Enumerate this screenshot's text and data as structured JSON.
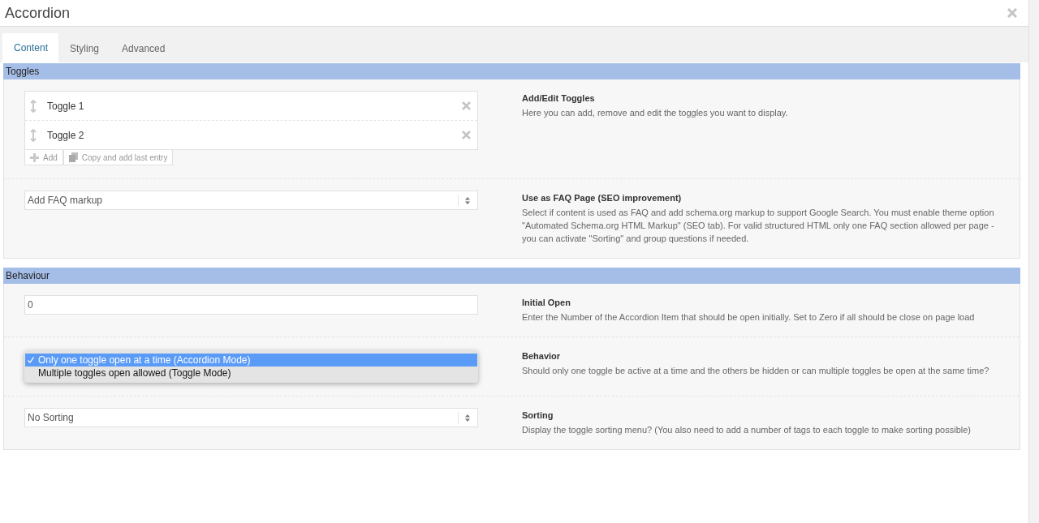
{
  "window": {
    "title": "Accordion"
  },
  "tabs": [
    {
      "label": "Content",
      "selected": true
    },
    {
      "label": "Styling",
      "selected": false
    },
    {
      "label": "Advanced",
      "selected": false
    }
  ],
  "sections": [
    {
      "title": "Toggles",
      "rows": [
        {
          "kind": "toggles",
          "items": [
            "Toggle 1",
            "Toggle 2"
          ],
          "actions": [
            "Add",
            "Copy and add last entry"
          ],
          "heading": "Add/Edit Toggles",
          "description": "Here you can add, remove and edit the toggles you want to display."
        },
        {
          "kind": "select",
          "value": "Add FAQ markup",
          "heading": "Use as FAQ Page (SEO improvement)",
          "description": "Select if content is used as FAQ and add schema.org markup to support Google Search. You must enable theme option \"Automated Schema.org HTML Markup\" (SEO tab). For valid structured HTML only one FAQ section allowed per page - you can activate \"Sorting\" and group questions if needed."
        }
      ]
    },
    {
      "title": "Behaviour",
      "rows": [
        {
          "kind": "input",
          "value": "0",
          "heading": "Initial Open",
          "description": "Enter the Number of the Accordion Item that should be open initially. Set to Zero if all should be close on page load"
        },
        {
          "kind": "dropdown",
          "options": [
            {
              "label": "Only one toggle open at a time (Accordion Mode)",
              "selected": true
            },
            {
              "label": "Multiple toggles open allowed (Toggle Mode)",
              "selected": false
            }
          ],
          "heading": "Behavior",
          "description": "Should only one toggle be active at a time and the others be hidden or can multiple toggles be open at the same time?"
        },
        {
          "kind": "select",
          "value": "No Sorting",
          "heading": "Sorting",
          "description": "Display the toggle sorting menu? (You also need to add a number of tags to each toggle to make sorting possible)"
        }
      ]
    }
  ]
}
